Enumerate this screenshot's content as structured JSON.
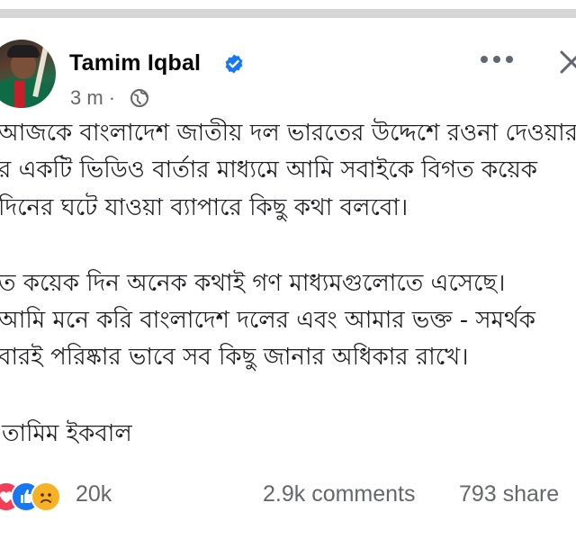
{
  "post": {
    "author": "Tamim Iqbal",
    "time": "3 m ·",
    "lines": [
      "আজকে বাংলাদেশ জাতীয় দল ভারতের উদ্দেশে রওনা দেওয়ার",
      "র একটি ভিডিও বার্তার মাধ্যমে আমি সবাইকে বিগত কয়েক",
      "দিনের ঘটে যাওয়া ব্যাপারে কিছু কথা বলবো।",
      "ত কয়েক দিন অনেক কথাই গণ মাধ্যমগুলোতে এসেছে।",
      "আমি মনে করি বাংলাদেশ দলের এবং আমার ভক্ত - সমর্থক",
      "বারই পরিষ্কার ভাবে সব কিছু জানার অধিকার রাখে।",
      "তামিম ইকবাল"
    ]
  },
  "engagement": {
    "reaction_count": "20k",
    "comments": "2.9k comments",
    "shares": "793 share"
  },
  "icons": {
    "verified": "verified-badge-icon",
    "privacy": "globe-icon",
    "more": "more-options-icon",
    "close": "close-icon",
    "reactions": [
      "love-reaction-icon",
      "like-reaction-icon",
      "sad-reaction-icon"
    ]
  },
  "colors": {
    "verified_blue": "#1877f2",
    "secondary_text": "#65676b"
  }
}
